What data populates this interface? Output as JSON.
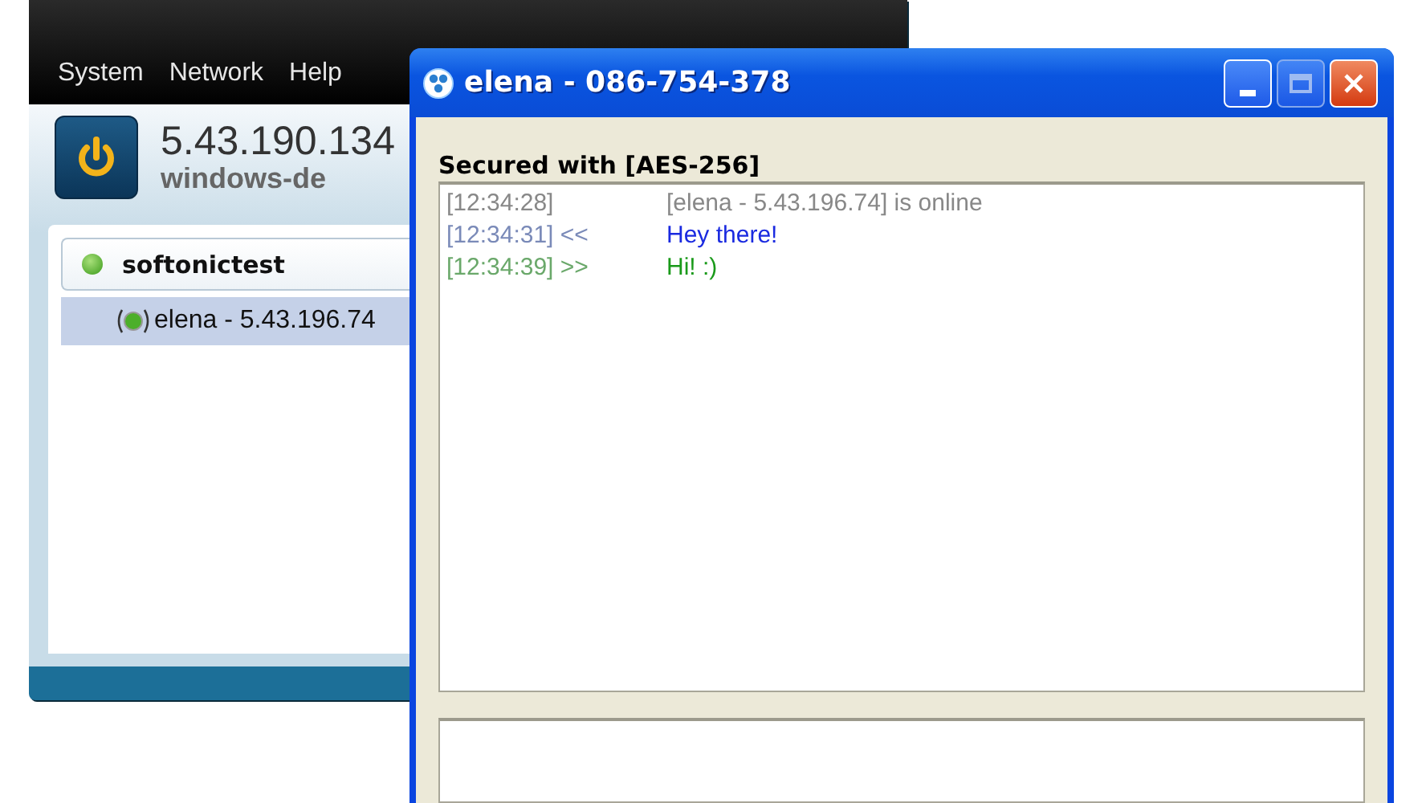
{
  "main_window": {
    "menu": [
      {
        "label": "System"
      },
      {
        "label": "Network"
      },
      {
        "label": "Help"
      }
    ],
    "client": {
      "address": "5.43.190.134",
      "hostname": "windows-de",
      "power_on": true
    },
    "networks": [
      {
        "name": "softonictest",
        "online": true,
        "selected": false,
        "members": [
          {
            "name": "elena - 5.43.196.74",
            "online": true,
            "selected": true
          }
        ]
      }
    ]
  },
  "chat_window": {
    "title": "elena - 086-754-378",
    "security": "Secured with [AES-256]",
    "messages": [
      {
        "kind": "status",
        "time": "[12:34:28]",
        "text": "[elena - 5.43.196.74] is online"
      },
      {
        "kind": "incoming",
        "time": "[12:34:31]",
        "direction": "<<",
        "text": "Hey there!"
      },
      {
        "kind": "outgoing",
        "time": "[12:34:39]",
        "direction": ">>",
        "text": "Hi! :)"
      }
    ]
  }
}
